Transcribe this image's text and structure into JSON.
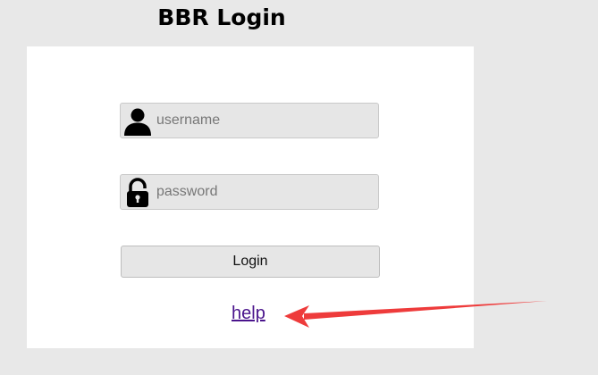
{
  "title": "BBR Login",
  "form": {
    "username": {
      "value": "",
      "placeholder": "username",
      "icon": "user-icon"
    },
    "password": {
      "value": "",
      "placeholder": "password",
      "icon": "lock-icon"
    },
    "login_label": "Login",
    "help_label": "help"
  },
  "annotation": {
    "arrow_color": "#ee3b3b",
    "points_to": "help-link"
  }
}
